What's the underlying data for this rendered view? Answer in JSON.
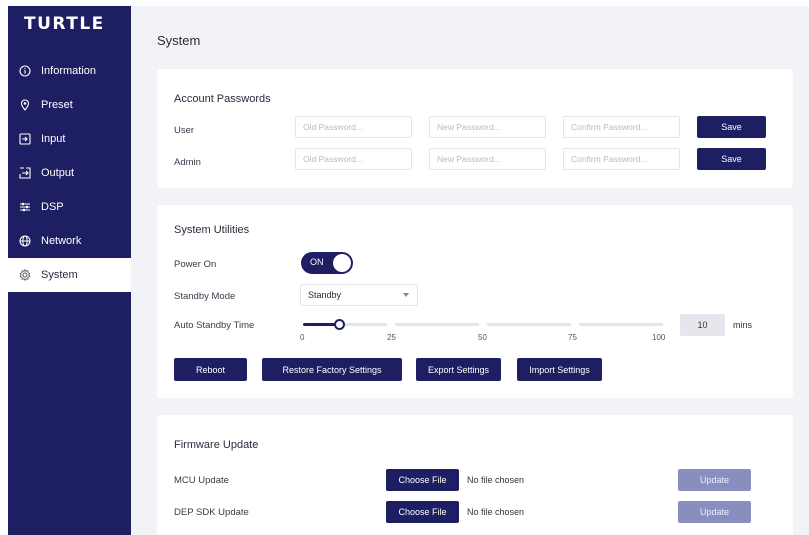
{
  "brand": {
    "logo": "TURTLE"
  },
  "sidebar": {
    "items": [
      {
        "label": "Information",
        "icon": "info-icon"
      },
      {
        "label": "Preset",
        "icon": "location-pin-icon"
      },
      {
        "label": "Input",
        "icon": "input-icon"
      },
      {
        "label": "Output",
        "icon": "output-icon"
      },
      {
        "label": "DSP",
        "icon": "equalizer-icon"
      },
      {
        "label": "Network",
        "icon": "globe-icon"
      },
      {
        "label": "System",
        "icon": "gear-icon",
        "active": true
      }
    ]
  },
  "page": {
    "title": "System"
  },
  "passwords": {
    "title": "Account Passwords",
    "rows": [
      {
        "label": "User",
        "old_placeholder": "Old Password...",
        "new_placeholder": "New Password...",
        "confirm_placeholder": "Confirm Password...",
        "save": "Save"
      },
      {
        "label": "Admin",
        "old_placeholder": "Old Password...",
        "new_placeholder": "New Password...",
        "confirm_placeholder": "Confirm Password...",
        "save": "Save"
      }
    ]
  },
  "utilities": {
    "title": "System Utilities",
    "power": {
      "label": "Power On",
      "state": "ON"
    },
    "standby": {
      "label": "Standby Mode",
      "value": "Standby"
    },
    "auto_standby": {
      "label": "Auto Standby Time",
      "ticks": [
        "0",
        "25",
        "50",
        "75",
        "100"
      ],
      "value": "10",
      "unit": "mins",
      "fraction": 0.1
    },
    "buttons": {
      "reboot": "Reboot",
      "restore": "Restore Factory Settings",
      "export": "Export Settings",
      "import": "Import Settings"
    }
  },
  "firmware": {
    "title": "Firmware Update",
    "rows": [
      {
        "label": "MCU Update",
        "choose": "Choose File",
        "status": "No file chosen",
        "update": "Update"
      },
      {
        "label": "DEP SDK Update",
        "choose": "Choose File",
        "status": "No file chosen",
        "update": "Update"
      }
    ]
  },
  "colors": {
    "navy": "#1e1f63",
    "disabled": "#8a8ebe",
    "background": "#f2f3f6"
  }
}
